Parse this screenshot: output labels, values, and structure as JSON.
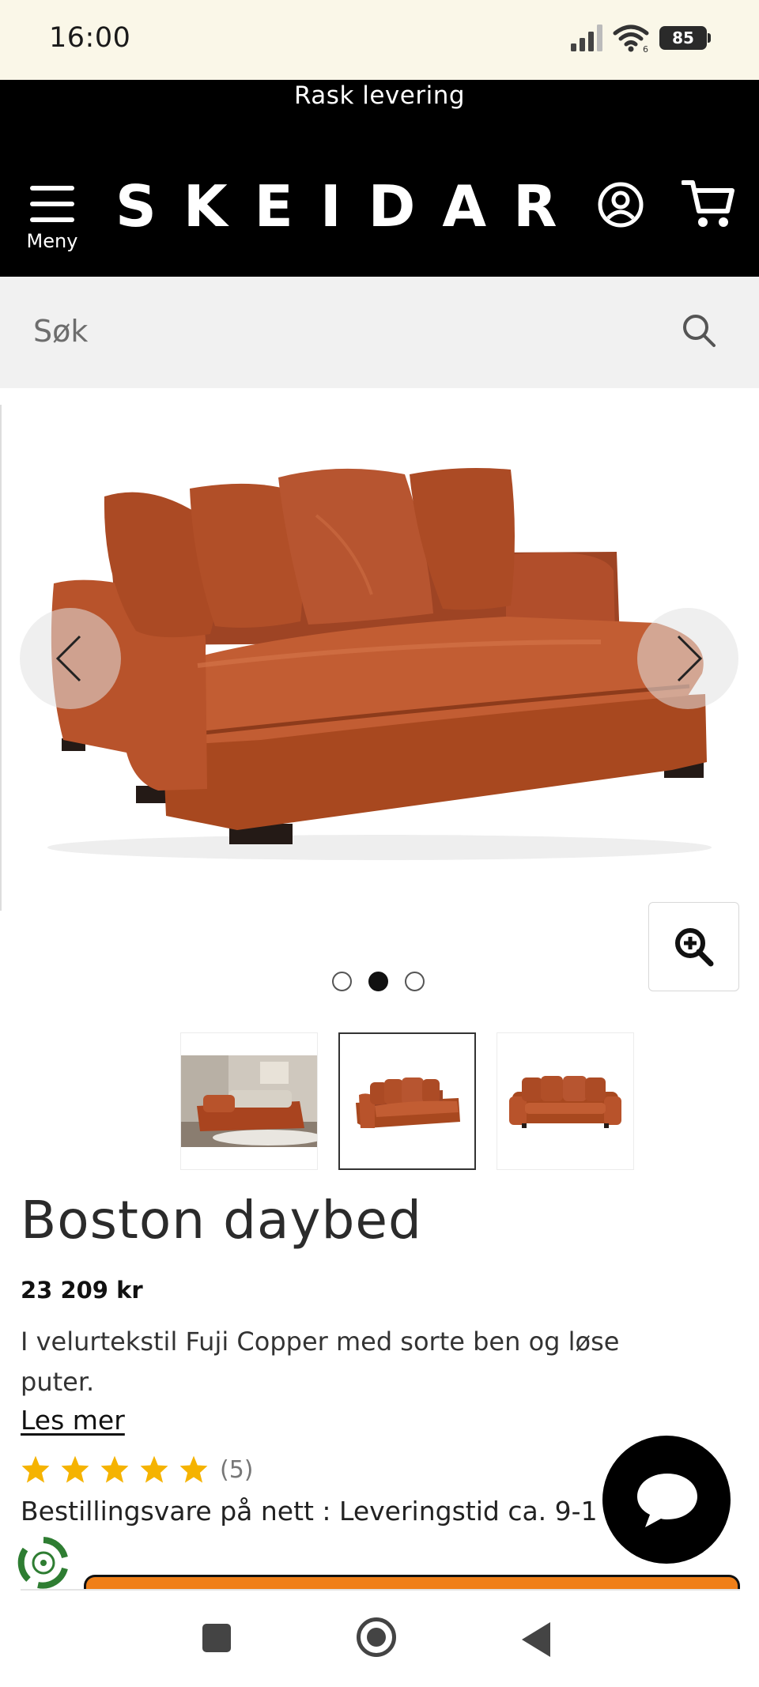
{
  "status_bar": {
    "time": "16:00",
    "battery": "85",
    "network_label": "6"
  },
  "header": {
    "promo": "Rask levering",
    "menu_label": "Meny",
    "logo": "SKEIDAR"
  },
  "search": {
    "placeholder": "Søk"
  },
  "gallery": {
    "total_images": 3,
    "active_index": 1
  },
  "product": {
    "title": "Boston daybed",
    "price": "23 209 kr",
    "description": "I velurtekstil Fuji Copper med sorte ben og løse puter.",
    "read_more": "Les mer",
    "rating_stars": 5,
    "review_count": "(5)",
    "delivery_text": "Bestillingsvare på nett : Leveringstid ca. 9-1"
  },
  "colors": {
    "fabric": "#b5532c",
    "accent_orange": "#f07f18",
    "star": "#f5b301",
    "header_bg": "#000000"
  },
  "icons": {
    "account": "account-icon",
    "cart": "cart-icon",
    "search": "search-icon",
    "zoom": "zoom-in-icon",
    "chat": "chat-icon",
    "recycle": "recycle-icon"
  }
}
